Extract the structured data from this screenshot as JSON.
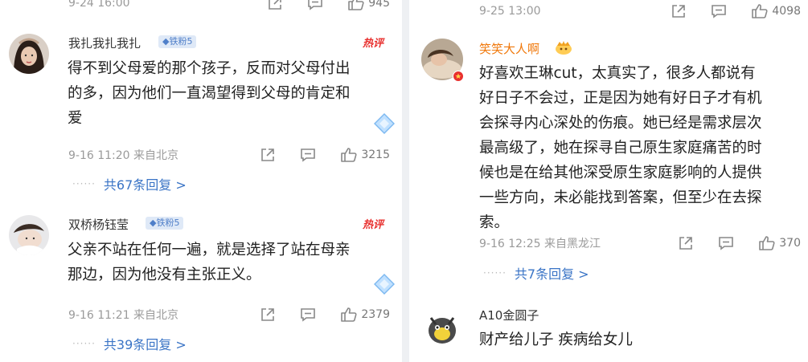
{
  "left": {
    "top_meta": {
      "time": "9-24 16:00",
      "like_count": "945"
    },
    "comments": [
      {
        "username": "我扎我扎我扎",
        "fan_badge": "铁粉5",
        "hot_label": "热评",
        "lines": [
          "得不到父母爱的那个孩子，反而对父母付出",
          "的多，因为他们一直渴望得到父母的肯定和",
          "爱"
        ],
        "time_location": "9-16 11:20 来自北京",
        "like_count": "3215",
        "replies": "共67条回复 >"
      },
      {
        "username": "双桥杨钰莹",
        "fan_badge": "铁粉5",
        "hot_label": "热评",
        "lines": [
          "父亲不站在任何一遍，就是选择了站在母亲",
          "那边，因为他没有主张正义。"
        ],
        "time_location": "9-16 11:21 来自北京",
        "like_count": "2379",
        "replies": "共39条回复 >"
      }
    ]
  },
  "right": {
    "top_meta": {
      "time": "9-25 13:00",
      "like_count": "4098"
    },
    "comments": [
      {
        "username": "笑笑大人啊",
        "lines": [
          "好喜欢王琳cut，太真实了，很多人都说有",
          "好日子不会过，正是因为她有好日子才有机",
          "会探寻内心深处的伤痕。她已经是需求层次",
          "最高级了，她在探寻自己原生家庭痛苦的时",
          "候也是在给其他深受原生家庭影响的人提供",
          "一些方向，未必能找到答案，但至少在去探",
          "索。"
        ],
        "time_location": "9-16 12:25 来自黑龙江",
        "like_count": "370",
        "replies": "共7条回复 >"
      },
      {
        "username": "A10金圆子",
        "lines": [
          "财产给儿子 疾病给女儿"
        ]
      }
    ]
  },
  "colors": {
    "username_vip": "#f0780b",
    "link": "#3a74c6",
    "hot": "#e8302e",
    "meta": "#9a9a9a"
  }
}
